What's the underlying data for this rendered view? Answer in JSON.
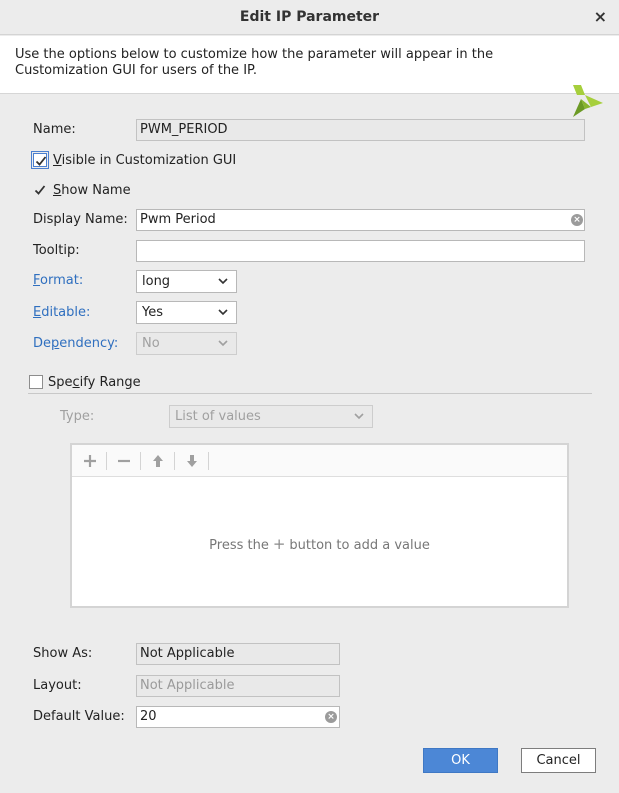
{
  "dialog": {
    "title": "Edit IP Parameter",
    "close_symbol": "×",
    "banner_text": "Use the options below to customize how the parameter will appear in the Customization GUI for users of the IP."
  },
  "form": {
    "name_label": "Name:",
    "name_value": "PWM_PERIOD",
    "visible_label_u": "V",
    "visible_label_rest": "isible in Customization GUI",
    "visible_checked": true,
    "show_name_label_u": "S",
    "show_name_label_rest": "how Name",
    "show_name_checked": true,
    "display_name_label": "Display Name:",
    "display_name_value": "Pwm Period",
    "tooltip_label": "Tooltip:",
    "tooltip_value": "",
    "format_label_u": "F",
    "format_label_rest": "ormat:",
    "format_value": "long",
    "editable_label_u": "E",
    "editable_label_rest": "ditable:",
    "editable_value": "Yes",
    "dependency_label_pre": "De",
    "dependency_label_u": "p",
    "dependency_label_rest": "endency:",
    "dependency_value": "No"
  },
  "range": {
    "specify_label_pre": "Spe",
    "specify_label_u": "c",
    "specify_label_rest": "ify Range",
    "specify_checked": false,
    "type_label": "Type:",
    "type_value": "List of values",
    "empty_pre": "Press the",
    "empty_plus": "+",
    "empty_post": "button to add a value"
  },
  "bottom": {
    "show_as_label": "Show As:",
    "show_as_value": "Not Applicable",
    "layout_label": "Layout:",
    "layout_value": "Not Applicable",
    "default_label": "Default Value:",
    "default_value": "20"
  },
  "buttons": {
    "ok": "OK",
    "cancel": "Cancel"
  },
  "colors": {
    "accent": "#4c87d6",
    "link": "#2f6fbf",
    "logo_green_light": "#a6cf3c",
    "logo_green_dark": "#6c9a25"
  }
}
